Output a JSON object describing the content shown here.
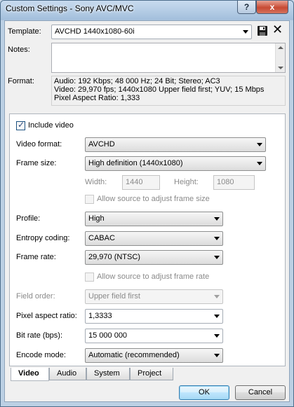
{
  "window": {
    "title": "Custom Settings - Sony AVC/MVC",
    "help_label": "?",
    "close_label": "x"
  },
  "template": {
    "label": "Template:",
    "value": "AVCHD 1440x1080-60i"
  },
  "notes": {
    "label": "Notes:",
    "value": ""
  },
  "format": {
    "label": "Format:",
    "lines": [
      "Audio: 192 Kbps; 48 000 Hz; 24 Bit; Stereo; AC3",
      "Video: 29,970 fps; 1440x1080 Upper field first; YUV; 15 Mbps",
      "Pixel Aspect Ratio: 1,333"
    ]
  },
  "video": {
    "include_video_label": "Include video",
    "include_video_checked": true,
    "video_format_label": "Video format:",
    "video_format_value": "AVCHD",
    "frame_size_label": "Frame size:",
    "frame_size_value": "High definition (1440x1080)",
    "width_label": "Width:",
    "width_value": "1440",
    "height_label": "Height:",
    "height_value": "1080",
    "allow_frame_size_label": "Allow source to adjust frame size",
    "profile_label": "Profile:",
    "profile_value": "High",
    "entropy_label": "Entropy coding:",
    "entropy_value": "CABAC",
    "frame_rate_label": "Frame rate:",
    "frame_rate_value": "29,970 (NTSC)",
    "allow_frame_rate_label": "Allow source to adjust frame rate",
    "field_order_label": "Field order:",
    "field_order_value": "Upper field first",
    "par_label": "Pixel aspect ratio:",
    "par_value": "1,3333",
    "bitrate_label": "Bit rate (bps):",
    "bitrate_value": "15 000 000",
    "encode_label": "Encode mode:",
    "encode_value": "Automatic (recommended)"
  },
  "tabs": [
    "Video",
    "Audio",
    "System",
    "Project"
  ],
  "buttons": {
    "ok": "OK",
    "cancel": "Cancel"
  }
}
